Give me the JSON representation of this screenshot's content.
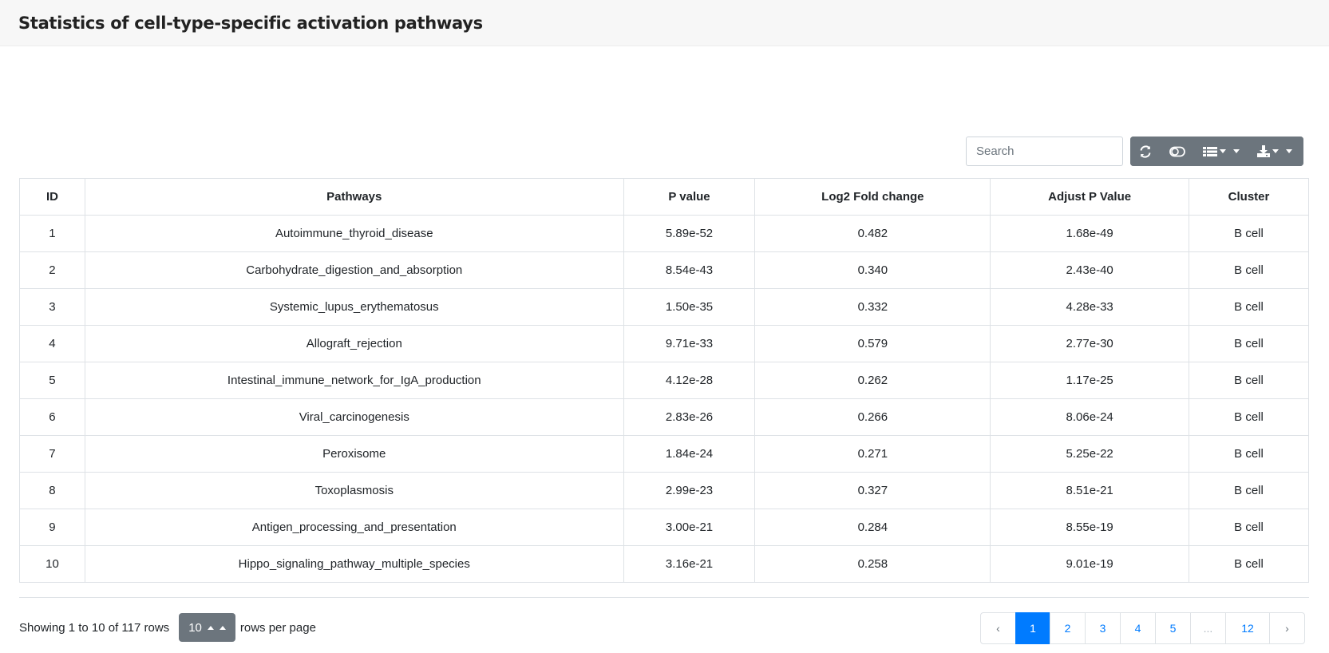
{
  "header": {
    "title": "Statistics of cell-type-specific activation pathways"
  },
  "toolbar": {
    "search_placeholder": "Search",
    "buttons": [
      "refresh-icon",
      "toggle-icon",
      "columns-icon",
      "export-icon"
    ]
  },
  "table": {
    "columns": [
      "ID",
      "Pathways",
      "P value",
      "Log2 Fold change",
      "Adjust P Value",
      "Cluster"
    ],
    "rows": [
      [
        "1",
        "Autoimmune_thyroid_disease",
        "5.89e-52",
        "0.482",
        "1.68e-49",
        "B cell"
      ],
      [
        "2",
        "Carbohydrate_digestion_and_absorption",
        "8.54e-43",
        "0.340",
        "2.43e-40",
        "B cell"
      ],
      [
        "3",
        "Systemic_lupus_erythematosus",
        "1.50e-35",
        "0.332",
        "4.28e-33",
        "B cell"
      ],
      [
        "4",
        "Allograft_rejection",
        "9.71e-33",
        "0.579",
        "2.77e-30",
        "B cell"
      ],
      [
        "5",
        "Intestinal_immune_network_for_IgA_production",
        "4.12e-28",
        "0.262",
        "1.17e-25",
        "B cell"
      ],
      [
        "6",
        "Viral_carcinogenesis",
        "2.83e-26",
        "0.266",
        "8.06e-24",
        "B cell"
      ],
      [
        "7",
        "Peroxisome",
        "1.84e-24",
        "0.271",
        "5.25e-22",
        "B cell"
      ],
      [
        "8",
        "Toxoplasmosis",
        "2.99e-23",
        "0.327",
        "8.51e-21",
        "B cell"
      ],
      [
        "9",
        "Antigen_processing_and_presentation",
        "3.00e-21",
        "0.284",
        "8.55e-19",
        "B cell"
      ],
      [
        "10",
        "Hippo_signaling_pathway_multiple_species",
        "3.16e-21",
        "0.258",
        "9.01e-19",
        "B cell"
      ]
    ]
  },
  "pagination": {
    "showing_text": "Showing 1 to 10 of 117 rows",
    "rows_per_page_value": "10",
    "rows_per_page_label": "rows per page",
    "pages": [
      "‹",
      "1",
      "2",
      "3",
      "4",
      "5",
      "...",
      "12",
      "›"
    ],
    "active_page": "1"
  },
  "colors": {
    "accent": "#007bff",
    "toolbar_button": "#6c757d"
  }
}
